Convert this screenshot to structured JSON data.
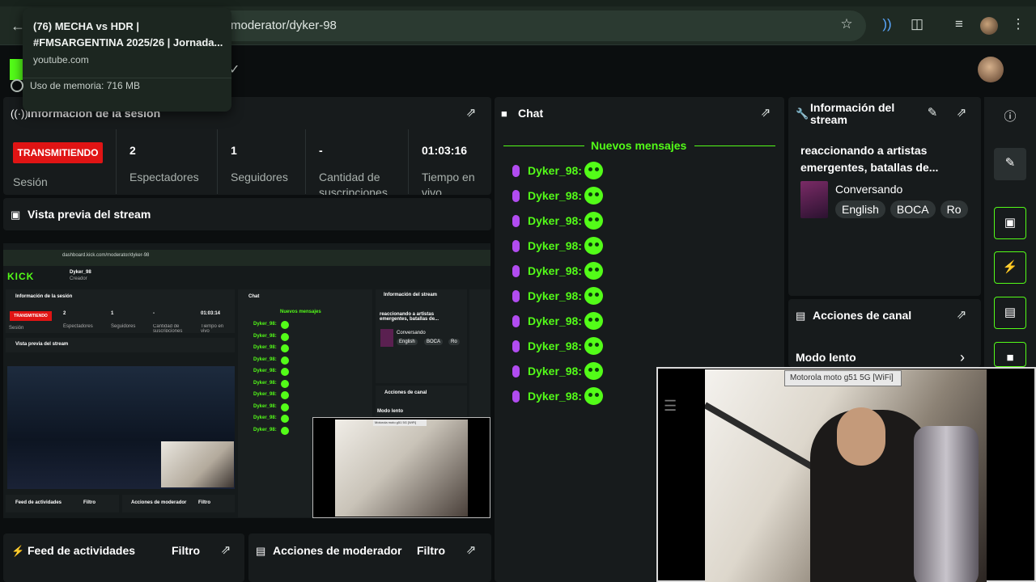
{
  "browser": {
    "url": "moderator/dyker-98",
    "tooltip": {
      "title": "(76) MECHA vs HDR | #FMSARGENTINA 2025/26 | Jornada...",
      "domain": "youtube.com",
      "memory": "Uso de memoria: 716 MB"
    },
    "icons": [
      "back-icon",
      "star-icon",
      "cast-icon",
      "extensions-icon",
      "media-icon",
      "profile-avatar",
      "more-icon"
    ]
  },
  "session": {
    "title": "Información de la sesión",
    "live_badge": "TRANSMITIENDO",
    "session_label": "Sesión",
    "stats": [
      {
        "value": "2",
        "label": "Espectadores"
      },
      {
        "value": "1",
        "label": "Seguidores"
      },
      {
        "value": "-",
        "label": "Cantidad de suscripciones"
      },
      {
        "value": "01:03:16",
        "label": "Tiempo en vivo"
      }
    ]
  },
  "preview": {
    "title": "Vista previa del stream",
    "mini": {
      "url": "dashboard.kick.com/moderator/dyker-98",
      "logo": "KICK",
      "user": "Dyker_98",
      "role": "Creador",
      "session_title": "Información de la sesión",
      "chat_title": "Chat",
      "info_title": "Información del stream",
      "new_msgs": "Nuevos mensajes",
      "live_badge": "TRANSMITIENDO",
      "time": "01:03:14",
      "stats": [
        "2",
        "1",
        "-"
      ],
      "labels": [
        "Sesión",
        "Espectadores",
        "Seguidores",
        "Cantidad de suscripciones",
        "Tiempo en vivo"
      ],
      "stream_title": "reaccionando a artistas emergentes, batallas de...",
      "category": "Conversando",
      "tags": [
        "English",
        "BOCA",
        "Ro"
      ],
      "preview_title": "Vista previa del stream",
      "channel_actions": "Acciones de canal",
      "slow_mode": "Modo lento",
      "activity": "Feed de actividades",
      "mod_actions": "Acciones de moderador",
      "filter": "Filtro",
      "cam_label": "Motorola moto g51 5G [WiFi]"
    }
  },
  "activity": {
    "title": "Feed de actividades",
    "filter": "Filtro"
  },
  "mod_actions": {
    "title": "Acciones de moderador",
    "filter": "Filtro"
  },
  "chat": {
    "title": "Chat",
    "new_messages": "Nuevos mensajes",
    "messages": [
      {
        "user": "Dyker_98:",
        "emote": "heart-eyes-emote"
      },
      {
        "user": "Dyker_98:",
        "emote": "smirk-emote"
      },
      {
        "user": "Dyker_98:",
        "emote": "neutral-emote"
      },
      {
        "user": "Dyker_98:",
        "emote": "grin-emote"
      },
      {
        "user": "Dyker_98:",
        "emote": "wink-emote"
      },
      {
        "user": "Dyker_98:",
        "emote": "goggles-emote"
      },
      {
        "user": "Dyker_98:",
        "emote": "happy-emote"
      },
      {
        "user": "Dyker_98:",
        "emote": "dizzy-emote"
      },
      {
        "user": "Dyker_98:",
        "emote": "angry-emote"
      },
      {
        "user": "Dyker_98:",
        "emote": "sad-emote"
      }
    ]
  },
  "stream_info": {
    "title": "Información del stream",
    "stream_title": "reaccionando a artistas emergentes, batallas de...",
    "category": "Conversando",
    "tags": [
      "English",
      "BOCA",
      "Ro"
    ]
  },
  "channel_actions": {
    "title": "Acciones de canal",
    "slow_mode": "Modo lento"
  },
  "camera": {
    "device_label": "Motorola moto g51 5G [WiFi]"
  },
  "colors": {
    "accent": "#53fc18",
    "live": "#e01414",
    "mic": "#b14cf0"
  }
}
